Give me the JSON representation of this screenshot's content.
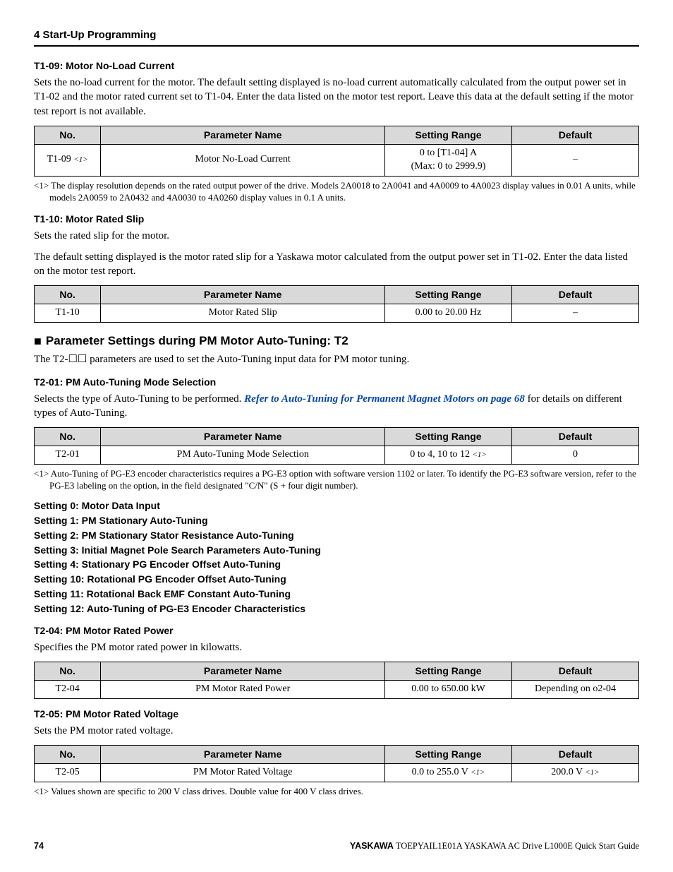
{
  "chapter": "4  Start-Up Programming",
  "t109": {
    "title": "T1-09: Motor No-Load Current",
    "desc": "Sets the no-load current for the motor. The default setting displayed is no-load current automatically calculated from the output power set in T1-02 and the motor rated current set to T1-04. Enter the data listed on the motor test report. Leave this data at the default setting if the motor test report is not available.",
    "row": {
      "no": "T1-09 ",
      "noSub": "<1>",
      "name": "Motor No-Load Current",
      "range": "0 to [T1-04] A\n(Max: 0 to 2999.9)",
      "def": "–"
    },
    "foot": "<1> The display resolution depends on the rated output power of the drive. Models 2A0018 to 2A0041 and 4A0009 to 4A0023 display values in 0.01 A units, while models 2A0059 to 2A0432 and 4A0030 to 4A0260 display values in 0.1 A units."
  },
  "t110": {
    "title": "T1-10: Motor Rated Slip",
    "p1": "Sets the rated slip for the motor.",
    "p2": "The default setting displayed is the motor rated slip for a Yaskawa motor calculated from the output power set in T1-02. Enter the data listed on the motor test report.",
    "row": {
      "no": "T1-10",
      "name": "Motor Rated Slip",
      "range": "0.00 to 20.00 Hz",
      "def": "–"
    }
  },
  "pm": {
    "title": "Parameter Settings during PM Motor Auto-Tuning: T2",
    "intro": "The T2-☐☐ parameters are used to set the Auto-Tuning input data for PM motor tuning."
  },
  "t201": {
    "title": "T2-01: PM Auto-Tuning Mode Selection",
    "descPre": "Selects the type of Auto-Tuning to be performed. ",
    "link": "Refer to Auto-Tuning for Permanent Magnet Motors on page 68",
    "descPost": " for details on different types of Auto-Tuning.",
    "row": {
      "no": "T2-01",
      "name": "PM Auto-Tuning Mode Selection",
      "range": "0 to 4, 10 to 12 ",
      "rangeSub": "<1>",
      "def": "0"
    },
    "foot": "<1> Auto-Tuning of PG-E3 encoder characteristics requires a PG-E3 option with software version 1102 or later. To identify the PG-E3 software version, refer to the PG-E3 labeling on the option, in the field designated \"C/N\" (S + four digit number)."
  },
  "settings": [
    "Setting 0: Motor Data Input",
    "Setting 1: PM Stationary Auto-Tuning",
    "Setting 2: PM Stationary Stator Resistance Auto-Tuning",
    "Setting 3: Initial Magnet Pole Search Parameters Auto-Tuning",
    "Setting 4: Stationary PG Encoder Offset Auto-Tuning",
    "Setting 10: Rotational PG Encoder Offset Auto-Tuning",
    "Setting 11: Rotational Back EMF Constant Auto-Tuning",
    "Setting 12: Auto-Tuning of PG-E3 Encoder Characteristics"
  ],
  "t204": {
    "title": "T2-04: PM Motor Rated Power",
    "desc": "Specifies the PM motor rated power in kilowatts.",
    "row": {
      "no": "T2-04",
      "name": "PM Motor Rated Power",
      "range": "0.00 to 650.00 kW",
      "def": "Depending on o2-04"
    }
  },
  "t205": {
    "title": "T2-05: PM Motor Rated Voltage",
    "desc": "Sets the PM motor rated voltage.",
    "row": {
      "no": "T2-05",
      "name": "PM Motor Rated Voltage",
      "range": "0.0 to 255.0 V ",
      "rangeSub": "<1>",
      "def": "200.0 V ",
      "defSub": "<1>"
    },
    "foot": "<1> Values shown are specific to 200 V class drives. Double value for 400 V class drives."
  },
  "headers": {
    "no": "No.",
    "name": "Parameter Name",
    "range": "Setting Range",
    "def": "Default"
  },
  "footer": {
    "page": "74",
    "brand": "YASKAWA",
    "doc": " TOEPYAIL1E01A YASKAWA AC Drive L1000E Quick Start Guide"
  }
}
